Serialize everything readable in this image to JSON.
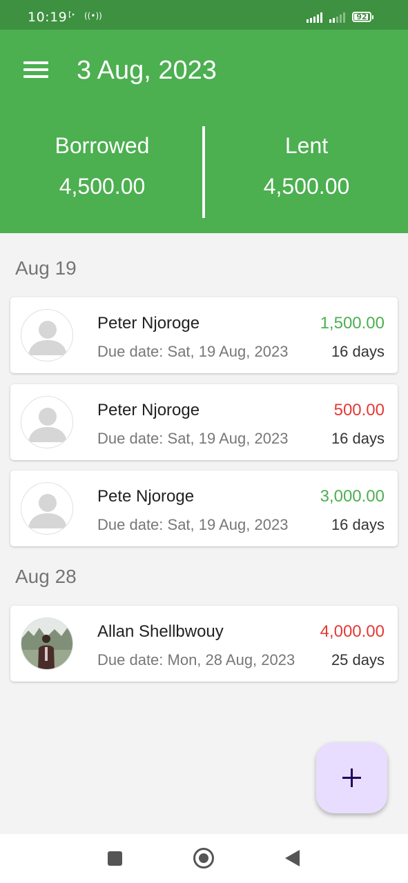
{
  "status_bar": {
    "time": "10:19",
    "battery": "92",
    "battery_level": 0.92
  },
  "header": {
    "title": "3 Aug, 2023",
    "borrowed_label": "Borrowed",
    "borrowed_value": "4,500.00",
    "lent_label": "Lent",
    "lent_value": "4,500.00"
  },
  "colors": {
    "primary": "#4caf50",
    "status_bar": "#3d9140",
    "positive_amount": "#4caf50",
    "negative_amount": "#e53935",
    "fab_background": "#e8ddff",
    "fab_icon": "#21005d"
  },
  "sections": [
    {
      "heading": "Aug 19",
      "items": [
        {
          "name": "Peter Njoroge",
          "due": "Due date: Sat, 19 Aug, 2023",
          "amount": "1,500.00",
          "amount_color": "#4caf50",
          "days": "16 days",
          "avatar": "default-person-icon"
        },
        {
          "name": "Peter Njoroge",
          "due": "Due date: Sat, 19 Aug, 2023",
          "amount": "500.00",
          "amount_color": "#e53935",
          "days": "16 days",
          "avatar": "default-person-icon"
        },
        {
          "name": "Pete Njoroge",
          "due": "Due date: Sat, 19 Aug, 2023",
          "amount": "3,000.00",
          "amount_color": "#4caf50",
          "days": "16 days",
          "avatar": "default-person-icon"
        }
      ]
    },
    {
      "heading": "Aug 28",
      "items": [
        {
          "name": "Allan Shellbwouy",
          "due": "Due date: Mon, 28 Aug, 2023",
          "amount": "4,000.00",
          "amount_color": "#e53935",
          "days": "25 days",
          "avatar": "profile-photo"
        }
      ]
    }
  ],
  "icons": {
    "menu": "menu-icon",
    "fab": "plus-icon",
    "nav_recents": "square-icon",
    "nav_home": "circle-icon",
    "nav_back": "triangle-back-icon"
  }
}
